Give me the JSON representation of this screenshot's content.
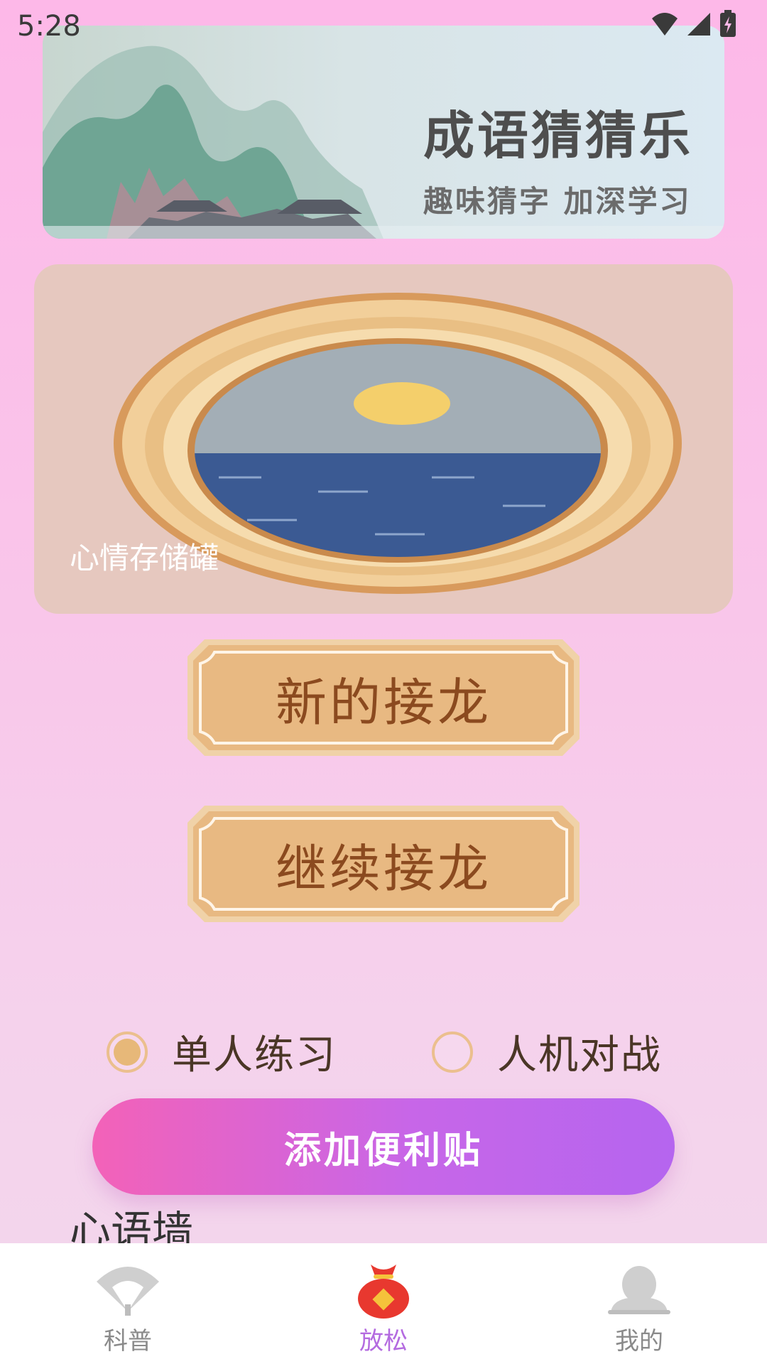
{
  "status_bar": {
    "time": "5:28"
  },
  "banner": {
    "title": "成语猜猜乐",
    "subtitle": "趣味猜字 加深学习"
  },
  "mood_card": {
    "label": "心情存储罐"
  },
  "buttons": {
    "new_chain": "新的接龙",
    "continue_chain": "继续接龙"
  },
  "modes": [
    {
      "label": "单人练习",
      "selected": true
    },
    {
      "label": "人机对战",
      "selected": false
    }
  ],
  "add_note": {
    "label": "添加便利贴"
  },
  "wall": {
    "title": "心语墙"
  },
  "tabs": [
    {
      "label": "科普",
      "icon": "fan-icon",
      "active": false
    },
    {
      "label": "放松",
      "icon": "lucky-bag-icon",
      "active": true
    },
    {
      "label": "我的",
      "icon": "person-icon",
      "active": false
    }
  ],
  "colors": {
    "accent": "#b46be0",
    "button_text": "#8b4a1f",
    "pink_gradient_start": "#f362b8",
    "purple_gradient_end": "#b565ef"
  }
}
